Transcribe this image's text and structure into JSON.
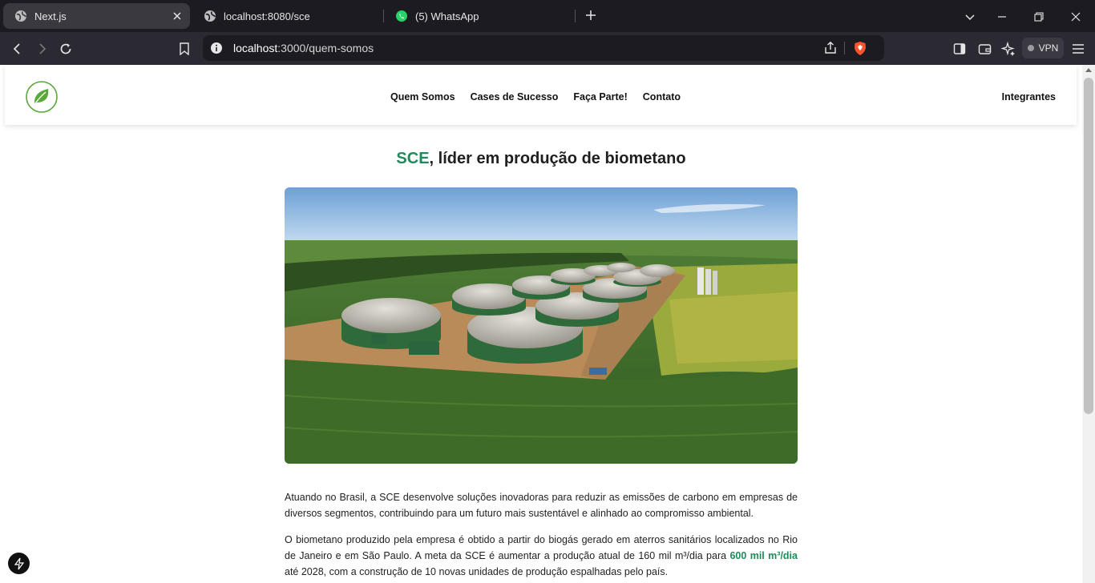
{
  "browser": {
    "tabs": [
      {
        "title": "Next.js",
        "favicon": "globe-icon",
        "active": true
      },
      {
        "title": "localhost:8080/sce",
        "favicon": "globe-icon",
        "active": false
      },
      {
        "title": "(5) WhatsApp",
        "favicon": "whatsapp-icon",
        "active": false
      }
    ],
    "url": {
      "host": "localhost",
      "path": ":3000/quem-somos"
    },
    "vpn_label": "VPN"
  },
  "header": {
    "nav": [
      "Quem Somos",
      "Cases de Sucesso",
      "Faça Parte!",
      "Contato"
    ],
    "right_link": "Integrantes"
  },
  "page": {
    "title_brand": "SCE",
    "title_rest": ", líder em produção de biometano",
    "hero_image": "biogas-plant-aerial-photo",
    "paragraph1": "Atuando no Brasil, a SCE desenvolve soluções inovadoras para reduzir as emissões de carbono em empresas de diversos segmentos, contribuindo para um futuro mais sustentável e alinhado ao compromisso ambiental.",
    "paragraph2_start": "O biometano produzido pela empresa é obtido a partir do biogás gerado em aterros sanitários localizados no Rio de Janeiro e em São Paulo. A meta da SCE é aumentar a produção atual de 160 mil m³/dia para ",
    "paragraph2_highlight": "600 mil m³/dia",
    "paragraph2_end": " até 2028, com a construção de 10 novas unidades de produção espalhadas pelo país."
  },
  "colors": {
    "brand": "#1f8a5b",
    "chrome_dark": "#1c1b22",
    "toolbar": "#2b2a33"
  }
}
